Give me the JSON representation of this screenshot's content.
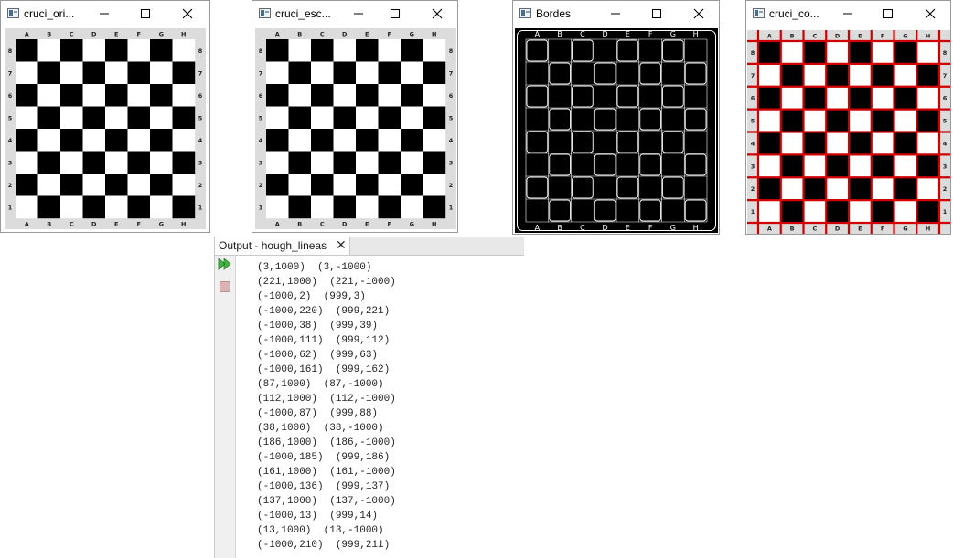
{
  "windows": [
    {
      "title": "cruci_ori...",
      "variant": "normal"
    },
    {
      "title": "cruci_esc...",
      "variant": "normal"
    },
    {
      "title": "Bordes",
      "variant": "edges"
    },
    {
      "title": "cruci_co...",
      "variant": "lines"
    }
  ],
  "board": {
    "files": [
      "A",
      "B",
      "C",
      "D",
      "E",
      "F",
      "G",
      "H"
    ],
    "ranks": [
      "8",
      "7",
      "6",
      "5",
      "4",
      "3",
      "2",
      "1"
    ]
  },
  "output_panel": {
    "tab_label": "Output - hough_lineas",
    "close_glyph": "✕",
    "lines": [
      "(3,1000)  (3,-1000)",
      "(221,1000)  (221,-1000)",
      "(-1000,2)  (999,3)",
      "(-1000,220)  (999,221)",
      "(-1000,38)  (999,39)",
      "(-1000,111)  (999,112)",
      "(-1000,62)  (999,63)",
      "(-1000,161)  (999,162)",
      "(87,1000)  (87,-1000)",
      "(112,1000)  (112,-1000)",
      "(-1000,87)  (999,88)",
      "(38,1000)  (38,-1000)",
      "(186,1000)  (186,-1000)",
      "(-1000,185)  (999,186)",
      "(161,1000)  (161,-1000)",
      "(-1000,136)  (999,137)",
      "(137,1000)  (137,-1000)",
      "(-1000,13)  (999,14)",
      "(13,1000)  (13,-1000)",
      "(-1000,210)  (999,211)"
    ]
  },
  "colors": {
    "dark_square": "#000000",
    "light_square": "#ffffff",
    "border_gray": "#dcdcdc",
    "hough_line": "#d00000",
    "edge_line": "#ffffff"
  },
  "icons": [
    "window-app-icon",
    "minimize-icon",
    "maximize-icon",
    "close-icon",
    "rerun-icon",
    "stop-icon"
  ]
}
